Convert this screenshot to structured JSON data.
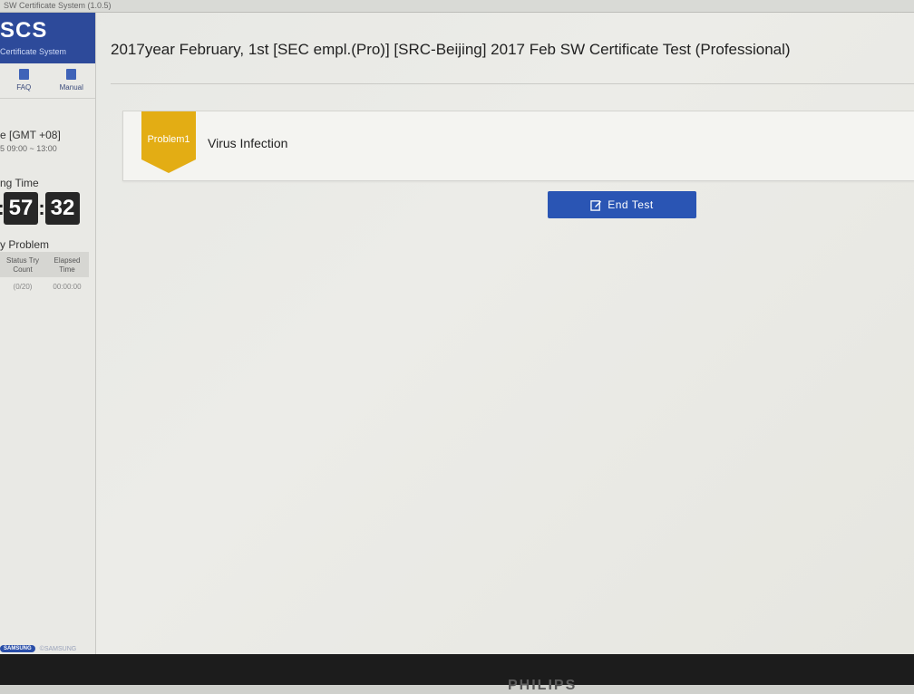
{
  "window": {
    "title": "SW Certificate System (1.0.5)"
  },
  "sidebar": {
    "brand": {
      "logo": "SCS",
      "subtitle": "Certificate System"
    },
    "quicklinks": [
      {
        "label": "FAQ",
        "icon": "faq-icon"
      },
      {
        "label": "Manual",
        "icon": "manual-icon"
      }
    ],
    "test_time": {
      "label": "e [GMT +08]",
      "range": "5 09:00 ~ 13:00"
    },
    "remaining": {
      "label": "ng Time",
      "minutes": "57",
      "seconds": "32"
    },
    "problem_section": {
      "label": "y Problem",
      "headers": [
        "Status Try Count",
        "Elapsed Time"
      ],
      "rows": [
        {
          "status": "(0/20)",
          "elapsed": "00:00:00"
        }
      ]
    },
    "footer": {
      "pill": "SAMSUNG",
      "text": "©SAMSUNG"
    }
  },
  "main": {
    "title": "2017year February, 1st [SEC empl.(Pro)] [SRC-Beijing] 2017 Feb SW Certificate Test (Professional)",
    "problem": {
      "badge": "Problem1",
      "name": "Virus Infection",
      "badge_color": "#e3ad14"
    },
    "end_button": {
      "label": "End Test",
      "icon": "edit-icon",
      "color": "#2a55b4"
    }
  },
  "monitor": {
    "brand": "PHILIPS"
  }
}
